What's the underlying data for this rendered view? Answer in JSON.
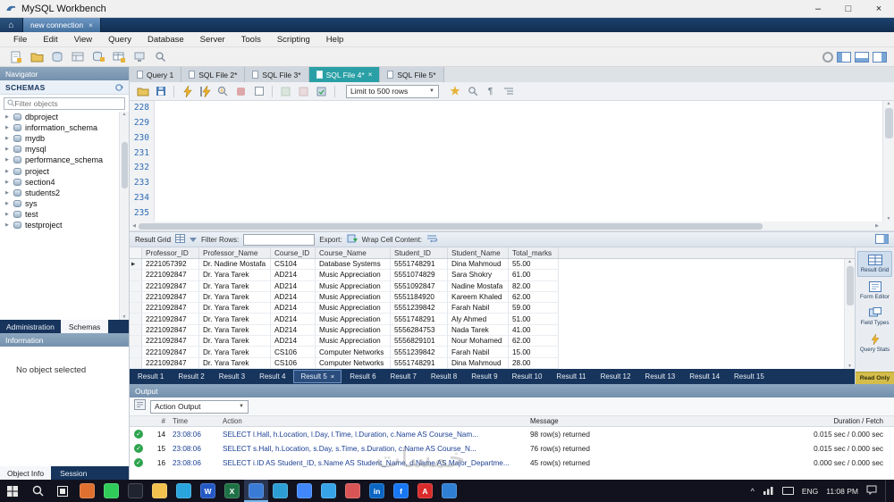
{
  "icons": {
    "minimize": "–",
    "maximize": "□",
    "close": "×",
    "home": "⌂",
    "dropdown_arrow": "▼",
    "row_marker": "▶",
    "check": "✓",
    "chevron_up": "^",
    "scroll_up": "▲",
    "scroll_down": "▼",
    "scroll_left": "◀",
    "scroll_right": "▶",
    "pilcrow": "¶",
    "expander": "▶"
  },
  "titlebar": {
    "title": "MySQL Workbench"
  },
  "connection": {
    "tab": "new connection"
  },
  "menu": {
    "items": [
      "File",
      "Edit",
      "View",
      "Query",
      "Database",
      "Server",
      "Tools",
      "Scripting",
      "Help"
    ]
  },
  "main_toolbar": {
    "left_icons": [
      "new-query-tab",
      "open-sql-script",
      "new-model",
      "open-model",
      "create-schema",
      "create-table",
      "server-status",
      "search"
    ],
    "right_icons": [
      "preferences",
      "toggle-sidebar",
      "toggle-output-area",
      "toggle-secondary-sidebar"
    ]
  },
  "query_tabs": {
    "tabs": [
      {
        "label": "Query 1"
      },
      {
        "label": "SQL File 2*"
      },
      {
        "label": "SQL File 3*"
      },
      {
        "label": "SQL File 4*",
        "active": true
      },
      {
        "label": "SQL File 5*"
      }
    ]
  },
  "sql_toolbar": {
    "limit": "Limit to 500 rows"
  },
  "editor": {
    "line_numbers": [
      "228",
      "229",
      "230",
      "231",
      "232",
      "233",
      "234",
      "235"
    ]
  },
  "navigator": {
    "title": "Navigator",
    "section": "SCHEMAS",
    "filter_placeholder": "Filter objects",
    "schemas": [
      "dbproject",
      "information_schema",
      "mydb",
      "mysql",
      "performance_schema",
      "project",
      "section4",
      "students2",
      "sys",
      "test",
      "testproject"
    ],
    "tab_administration": "Administration",
    "tab_schemas": "Schemas",
    "information_title": "Information",
    "information_text": "No object selected",
    "tab_object_info": "Object Info",
    "tab_session": "Session"
  },
  "result_grid": {
    "label": "Result Grid",
    "filter_label": "Filter Rows:",
    "export_label": "Export:",
    "wrap_label": "Wrap Cell Content:",
    "columns": [
      "Professor_ID",
      "Professor_Name",
      "Course_ID",
      "Course_Name",
      "Student_ID",
      "Student_Name",
      "Total_marks"
    ],
    "rows": [
      {
        "current": true,
        "cells": [
          "2221057392",
          "Dr. Nadine Mostafa",
          "CS104",
          "Database Systems",
          "5551748291",
          "Dina Mahmoud",
          "55.00"
        ]
      },
      {
        "cells": [
          "2221092847",
          "Dr. Yara Tarek",
          "AD214",
          "Music Appreciation",
          "5551074829",
          "Sara Shokry",
          "61.00"
        ]
      },
      {
        "cells": [
          "2221092847",
          "Dr. Yara Tarek",
          "AD214",
          "Music Appreciation",
          "5551092847",
          "Nadine Mostafa",
          "82.00"
        ]
      },
      {
        "cells": [
          "2221092847",
          "Dr. Yara Tarek",
          "AD214",
          "Music Appreciation",
          "5551184920",
          "Kareem Khaled",
          "62.00"
        ]
      },
      {
        "cells": [
          "2221092847",
          "Dr. Yara Tarek",
          "AD214",
          "Music Appreciation",
          "5551239842",
          "Farah Nabil",
          "59.00"
        ]
      },
      {
        "cells": [
          "2221092847",
          "Dr. Yara Tarek",
          "AD214",
          "Music Appreciation",
          "5551748291",
          "Aly Ahmed",
          "51.00"
        ]
      },
      {
        "cells": [
          "2221092847",
          "Dr. Yara Tarek",
          "AD214",
          "Music Appreciation",
          "5556284753",
          "Nada Tarek",
          "41.00"
        ]
      },
      {
        "cells": [
          "2221092847",
          "Dr. Yara Tarek",
          "AD214",
          "Music Appreciation",
          "5556829101",
          "Nour Mohamed",
          "62.00"
        ]
      },
      {
        "cells": [
          "2221092847",
          "Dr. Yara Tarek",
          "CS106",
          "Computer Networks",
          "5551239842",
          "Farah Nabil",
          "15.00"
        ]
      },
      {
        "cells": [
          "2221092847",
          "Dr. Yara Tarek",
          "CS106",
          "Computer Networks",
          "5551748291",
          "Dina Mahmoud",
          "28.00"
        ]
      }
    ]
  },
  "result_tabs": {
    "tabs": [
      {
        "label": "Result 1"
      },
      {
        "label": "Result 2"
      },
      {
        "label": "Result 3"
      },
      {
        "label": "Result 4"
      },
      {
        "label": "Result 5",
        "active": true
      },
      {
        "label": "Result 6"
      },
      {
        "label": "Result 7"
      },
      {
        "label": "Result 8"
      },
      {
        "label": "Result 9"
      },
      {
        "label": "Result 10"
      },
      {
        "label": "Result 11"
      },
      {
        "label": "Result 12"
      },
      {
        "label": "Result 13"
      },
      {
        "label": "Result 14"
      },
      {
        "label": "Result 15"
      }
    ]
  },
  "side_panel": {
    "buttons": [
      {
        "label": "Result Grid",
        "active": true
      },
      {
        "label": "Form Editor"
      },
      {
        "label": "Field Types"
      },
      {
        "label": "Query Stats"
      }
    ],
    "read_only": "Read Only"
  },
  "output": {
    "title": "Output",
    "mode": "Action Output",
    "columns": {
      "index": "#",
      "time": "Time",
      "action": "Action",
      "message": "Message",
      "duration": "Duration / Fetch"
    },
    "rows": [
      {
        "index": "14",
        "time": "23:08:06",
        "action": "SELECT l.Hall,  h.Location,  l.Day,  l.Time,  l.Duration,  c.Name AS Course_Nam...",
        "message": "98 row(s) returned",
        "duration": "0.015 sec / 0.000 sec"
      },
      {
        "index": "15",
        "time": "23:08:06",
        "action": "SELECT s.Hall,  h.Location,  s.Day,  s.Time,  s.Duration,  c.Name AS Course_N...",
        "message": "76 row(s) returned",
        "duration": "0.015 sec / 0.000 sec"
      },
      {
        "index": "16",
        "time": "23:08:06",
        "action": "SELECT i.ID AS Student_ID,  s.Name AS Student_Name,  d.Name AS Major_Departme...",
        "message": "45 row(s) returned",
        "duration": "0.000 sec / 0.000 sec"
      }
    ]
  },
  "taskbar": {
    "language": "ENG",
    "time": "11:08 PM",
    "apps": [
      {
        "name": "firefox",
        "color": "#e0702f"
      },
      {
        "name": "whatsapp",
        "color": "#2fcc5a"
      },
      {
        "name": "spotify",
        "color": "#1f2430"
      },
      {
        "name": "file-explorer",
        "color": "#f2c14e"
      },
      {
        "name": "telegram",
        "color": "#2aa4dd"
      },
      {
        "name": "word",
        "color": "#2458c5",
        "glyph": "W"
      },
      {
        "name": "excel",
        "color": "#1e7145",
        "glyph": "X"
      },
      {
        "name": "mysql-workbench",
        "color": "#3a7bd5",
        "active": true
      },
      {
        "name": "edge",
        "color": "#2d9ed4"
      },
      {
        "name": "zoom",
        "color": "#4087fc"
      },
      {
        "name": "photos",
        "color": "#37a4e8"
      },
      {
        "name": "paint",
        "color": "#d95555"
      },
      {
        "name": "linkedin",
        "color": "#0a66c2",
        "glyph": "in"
      },
      {
        "name": "facebook",
        "color": "#1877f2",
        "glyph": "f"
      },
      {
        "name": "acrobat",
        "color": "#d92b2b",
        "glyph": "A"
      },
      {
        "name": "onedrive",
        "color": "#2f7fd4"
      }
    ]
  },
  "watermark": {
    "text": "خمسات"
  }
}
